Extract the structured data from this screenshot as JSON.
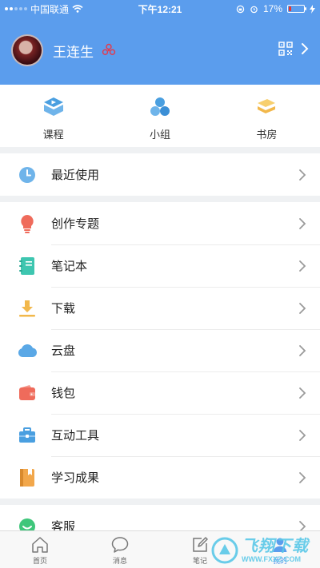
{
  "status_bar": {
    "carrier": "中国联通",
    "time": "下午12:21",
    "battery_percent": "17%",
    "battery_level": 0.17
  },
  "profile": {
    "username": "王连生"
  },
  "quick_actions": [
    {
      "label": "课程",
      "icon": "course-play-icon",
      "color": "#4a9fe0"
    },
    {
      "label": "小组",
      "icon": "group-circles-icon",
      "color": "#4a9fe0"
    },
    {
      "label": "书房",
      "icon": "study-books-icon",
      "color": "#f2b84b"
    }
  ],
  "recent": {
    "label": "最近使用",
    "icon": "clock-icon"
  },
  "menu": [
    {
      "label": "创作专题",
      "icon": "lightbulb-icon",
      "color": "#ef6b5b"
    },
    {
      "label": "笔记本",
      "icon": "notebook-icon",
      "color": "#3ec6b0"
    },
    {
      "label": "下载",
      "icon": "download-icon",
      "color": "#f2b84b"
    },
    {
      "label": "云盘",
      "icon": "cloud-icon",
      "color": "#4a9fe0"
    },
    {
      "label": "钱包",
      "icon": "wallet-icon",
      "color": "#ef6b5b"
    },
    {
      "label": "互动工具",
      "icon": "toolbox-icon",
      "color": "#4a9fe0"
    },
    {
      "label": "学习成果",
      "icon": "achievement-book-icon",
      "color": "#f2a74b"
    }
  ],
  "service": {
    "label": "客服",
    "icon": "customer-service-icon",
    "color": "#3ec67a"
  },
  "tabbar": [
    {
      "label": "首页",
      "icon": "home-icon"
    },
    {
      "label": "消息",
      "icon": "message-icon"
    },
    {
      "label": "笔记",
      "icon": "note-edit-icon"
    },
    {
      "label": "我的",
      "icon": "me-icon",
      "active": true
    }
  ],
  "watermark": {
    "main": "飞翔下载",
    "sub": "WWW.FXXZ.COM"
  },
  "colors": {
    "header": "#5b9ded",
    "background": "#eff1f3"
  }
}
